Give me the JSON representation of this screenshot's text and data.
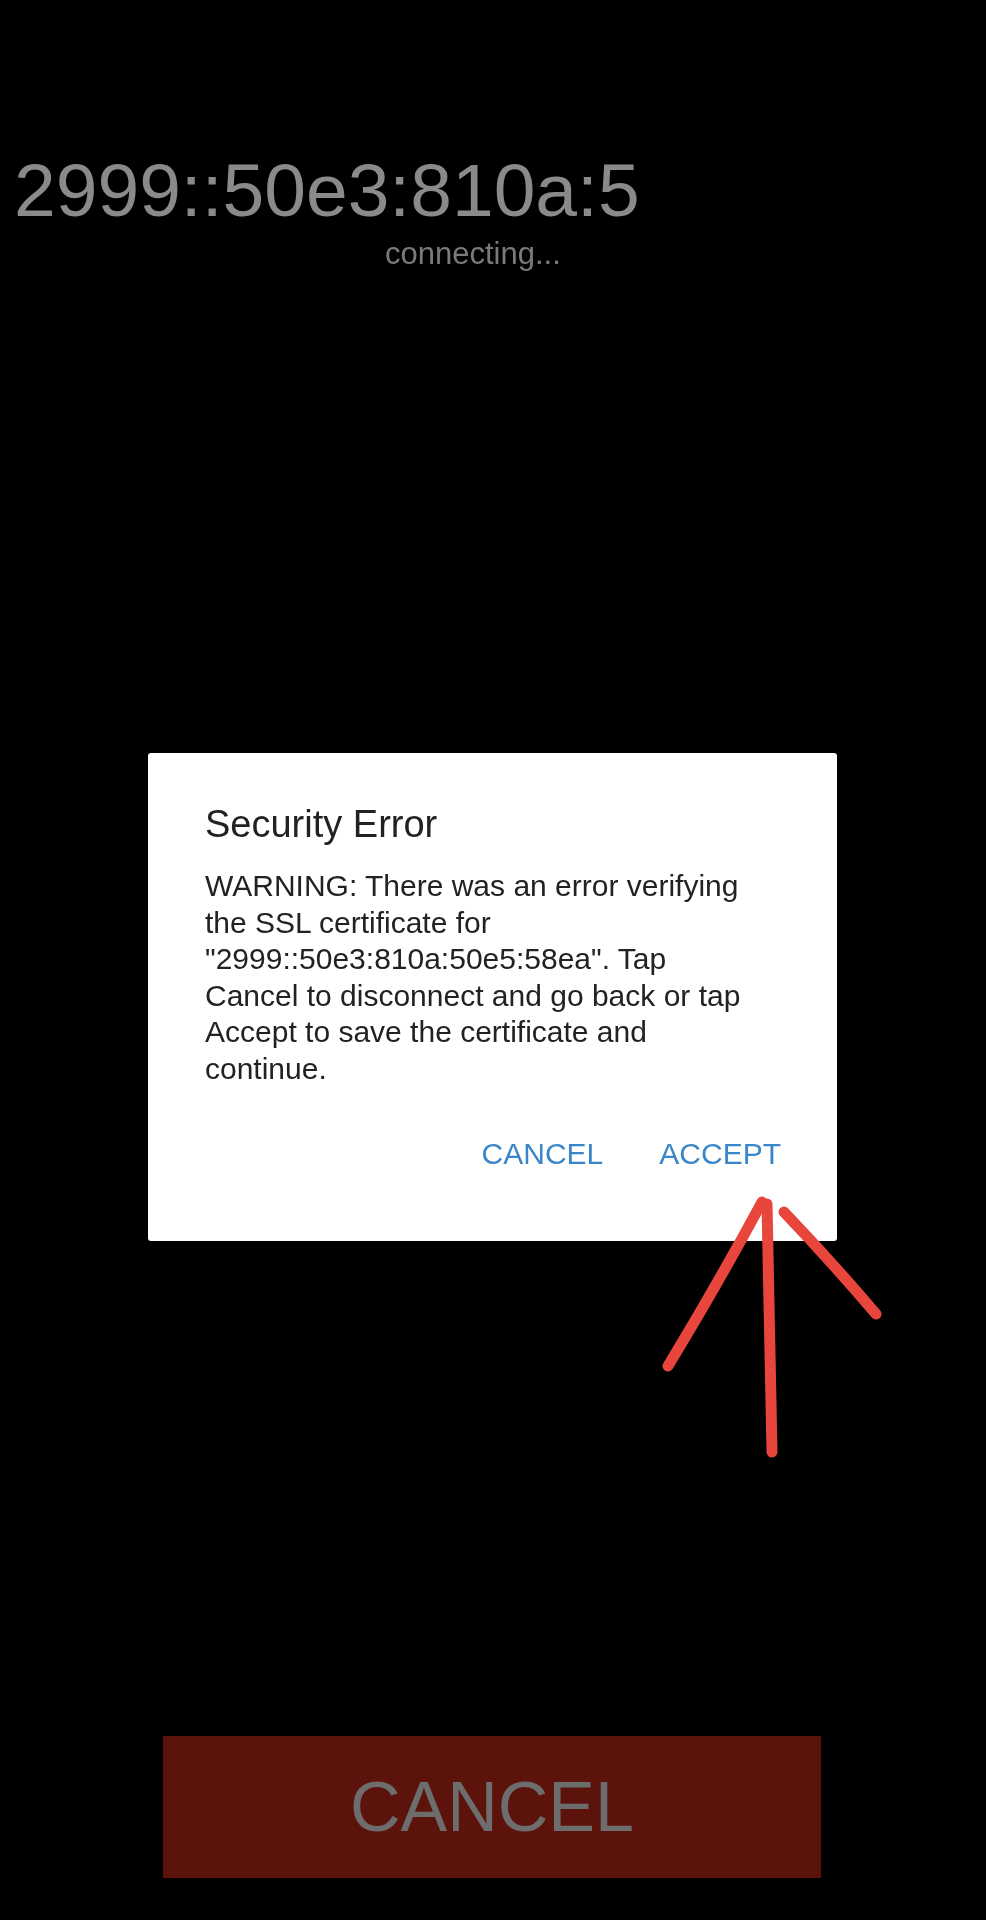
{
  "host": "2999::50e3:810a:5",
  "status": "connecting...",
  "dialog": {
    "title": "Security Error",
    "message": "WARNING: There was an error verifying the SSL certificate for \"2999::50e3:810a:50e5:58ea\". Tap Cancel to disconnect and go back or tap Accept to save the certificate and continue.",
    "buttons": [
      "CANCEL",
      "ACCEPT"
    ]
  },
  "cancel_button": "CANCEL"
}
